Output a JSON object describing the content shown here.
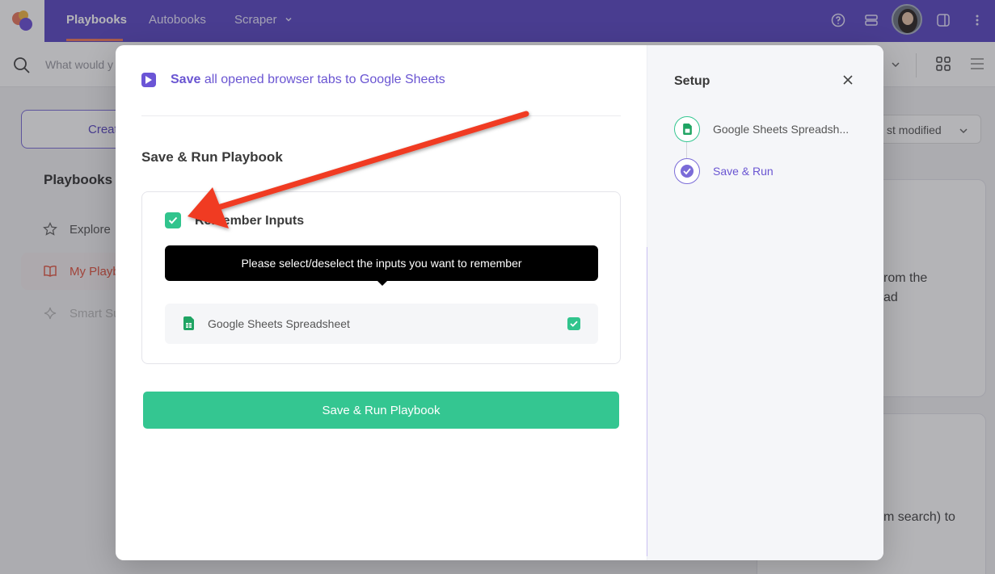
{
  "nav": {
    "items": [
      "Playbooks",
      "Autobooks",
      "Scraper"
    ],
    "active": "Playbooks"
  },
  "search": {
    "placeholder": "What would y"
  },
  "sidebar": {
    "create_label": "Creat",
    "title": "Playbooks",
    "items": [
      {
        "label": "Explore",
        "icon": "star-icon"
      },
      {
        "label": "My Playb",
        "icon": "book-icon"
      },
      {
        "label": "Smart Su",
        "icon": "sparkle-icon"
      }
    ]
  },
  "background": {
    "sort_label": "st modified",
    "card_text_1": "rom the",
    "card_text_2": "ad",
    "card_text_3": "m search) to"
  },
  "modal": {
    "playbook_title_bold": "Save",
    "playbook_title_rest": "all opened browser tabs to Google Sheets",
    "section_title": "Save & Run Playbook",
    "remember_label": "Remember Inputs",
    "tooltip": "Please select/deselect the inputs you want to remember",
    "inputs": [
      {
        "label": "Google Sheets Spreadsheet",
        "checked": true,
        "icon": "google-sheets-icon"
      }
    ],
    "run_button": "Save & Run Playbook"
  },
  "setup": {
    "title": "Setup",
    "steps": [
      {
        "label": "Google Sheets Spreadsh...",
        "icon": "google-sheets-icon"
      },
      {
        "label": "Save & Run",
        "icon": "check-circle-icon"
      }
    ]
  },
  "colors": {
    "brand_purple": "#5b49c4",
    "accent_green": "#34c691",
    "annotation_red": "#f03a24"
  }
}
